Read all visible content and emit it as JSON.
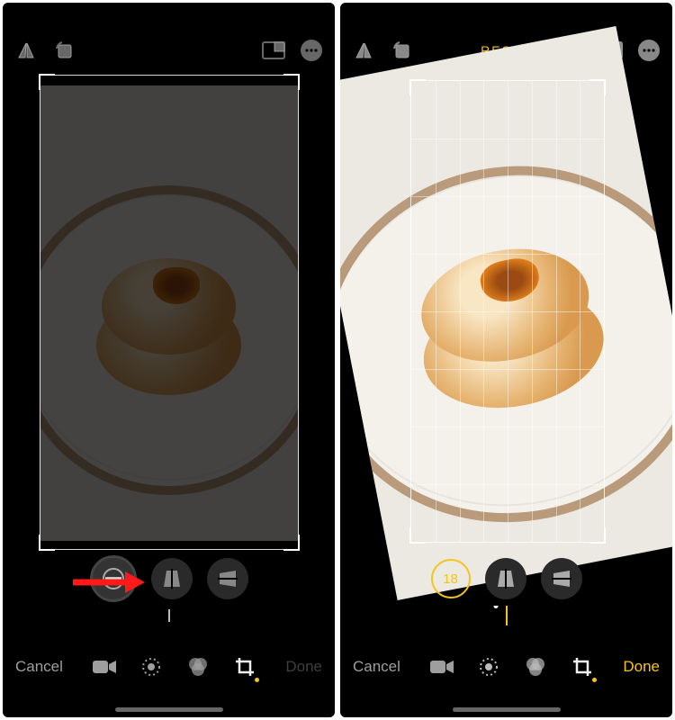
{
  "left": {
    "topbar": {
      "flip": "flip-vertical-icon",
      "rotate": "rotate-icon",
      "aspect": "aspect-ratio-icon",
      "more": "more-icon"
    },
    "controls": {
      "straighten": "straighten-icon",
      "vertical": "vertical-perspective-icon",
      "horizontal": "horizontal-perspective-icon"
    },
    "bottombar": {
      "cancel": "Cancel",
      "done": "Done"
    },
    "annotation": "arrow pointing to straighten button"
  },
  "right": {
    "topbar": {
      "reset": "RESET",
      "flip": "flip-vertical-icon",
      "rotate": "rotate-icon",
      "aspect": "aspect-ratio-icon",
      "more": "more-icon"
    },
    "controls": {
      "straighten_value": "18",
      "vertical": "vertical-perspective-icon",
      "horizontal": "horizontal-perspective-icon"
    },
    "bottombar": {
      "cancel": "Cancel",
      "done": "Done"
    }
  },
  "tools": {
    "video": "video-icon",
    "adjust": "adjust-icon",
    "filters": "filters-icon",
    "crop": "crop-rotate-icon"
  },
  "colors": {
    "accent": "#f5c518",
    "muted": "#9e9e9e"
  }
}
